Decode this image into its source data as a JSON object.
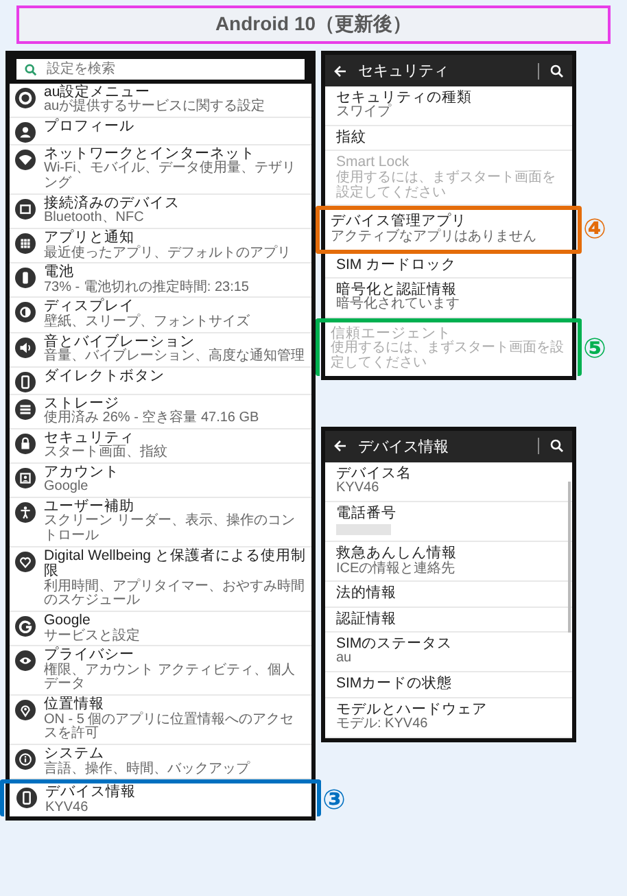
{
  "title": "Android 10（更新後）",
  "settings_screen": {
    "search": {
      "placeholder": "設定を検索"
    },
    "items": [
      {
        "title": "au設定メニュー",
        "subtitle": "auが提供するサービスに関する設定"
      },
      {
        "title": "プロフィール"
      },
      {
        "title": "ネットワークとインターネット",
        "subtitle": "Wi-Fi、モバイル、データ使用量、テザリング"
      },
      {
        "title": "接続済みのデバイス",
        "subtitle": "Bluetooth、NFC"
      },
      {
        "title": "アプリと通知",
        "subtitle": "最近使ったアプリ、デフォルトのアプリ"
      },
      {
        "title": "電池",
        "subtitle": "73% - 電池切れの推定時間: 23:15"
      },
      {
        "title": "ディスプレイ",
        "subtitle": "壁紙、スリープ、フォントサイズ"
      },
      {
        "title": "音とバイブレーション",
        "subtitle": "音量、バイブレーション、高度な通知管理"
      },
      {
        "title": "ダイレクトボタン"
      },
      {
        "title": "ストレージ",
        "subtitle": "使用済み 26% - 空き容量 47.16 GB"
      },
      {
        "title": "セキュリティ",
        "subtitle": "スタート画面、指紋"
      },
      {
        "title": "アカウント",
        "subtitle": "Google"
      },
      {
        "title": "ユーザー補助",
        "subtitle": "スクリーン リーダー、表示、操作のコントロール"
      },
      {
        "title": "Digital Wellbeing と保護者による使用制限",
        "subtitle": "利用時間、アプリタイマー、おやすみ時間のスケジュール"
      },
      {
        "title": "Google",
        "subtitle": "サービスと設定"
      },
      {
        "title": "プライバシー",
        "subtitle": "権限、アカウント アクティビティ、個人データ"
      },
      {
        "title": "位置情報",
        "subtitle": "ON - 5 個のアプリに位置情報へのアクセスを許可"
      },
      {
        "title": "システム",
        "subtitle": "言語、操作、時間、バックアップ"
      },
      {
        "title": "デバイス情報",
        "subtitle": "KYV46",
        "callout": {
          "number": "③",
          "color": "#0070c0"
        }
      }
    ]
  },
  "security_screen": {
    "title": "セキュリティ",
    "items": [
      {
        "title": "セキュリティの種類",
        "subtitle": "スワイプ",
        "disabled": false
      },
      {
        "title": "指紋",
        "disabled": false
      },
      {
        "title": "Smart Lock",
        "subtitle": "使用するには、まずスタート画面を設定してください",
        "disabled": true
      },
      {
        "title": "デバイス管理アプリ",
        "subtitle": "アクティブなアプリはありません",
        "disabled": false,
        "callout": {
          "number": "④",
          "color": "#e46c0a"
        }
      },
      {
        "title": "SIM カードロック",
        "disabled": false
      },
      {
        "title": "暗号化と認証情報",
        "subtitle": "暗号化されています",
        "disabled": false
      },
      {
        "title": "信頼エージェント",
        "subtitle": "使用するには、まずスタート画面を設定してください",
        "disabled": true,
        "callout": {
          "number": "⑤",
          "color": "#00b050"
        }
      }
    ]
  },
  "device_info_screen": {
    "title": "デバイス情報",
    "items": [
      {
        "title": "デバイス名",
        "subtitle": "KYV46"
      },
      {
        "title": "電話番号",
        "redacted": true
      },
      {
        "title": "救急あんしん情報",
        "subtitle": "ICEの情報と連絡先"
      },
      {
        "title": "法的情報"
      },
      {
        "title": "認証情報"
      },
      {
        "title": "SIMのステータス",
        "subtitle": "au"
      },
      {
        "title": "SIMカードの状態"
      },
      {
        "title": "モデルとハードウェア",
        "subtitle": "モデル: KYV46"
      }
    ]
  }
}
